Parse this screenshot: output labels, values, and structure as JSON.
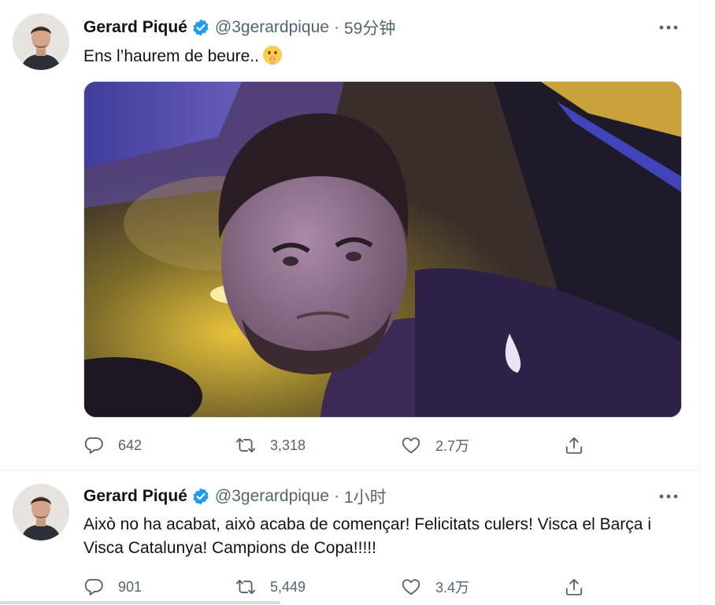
{
  "tweets": [
    {
      "author_name": "Gerard Piqué",
      "handle": "@3gerardpique",
      "separator": "·",
      "time": "59分钟",
      "text": "Ens l’haurem de beure..",
      "emoji": "shushing-face",
      "has_media": true,
      "replies": "642",
      "retweets": "3,318",
      "likes": "2.7万"
    },
    {
      "author_name": "Gerard Piqué",
      "handle": "@3gerardpique",
      "separator": "·",
      "time": "1小时",
      "text": "Això no ha acabat, això acaba de començar! Felicitats culers! Visca el Barça i Visca Catalunya! Campions de Copa!!!!!",
      "has_media": false,
      "replies": "901",
      "retweets": "5,449",
      "likes": "3.4万"
    }
  ],
  "colors": {
    "verified_badge": "#1d9bf0",
    "secondary_text": "#536471",
    "primary_text": "#0f1419"
  },
  "icons": [
    "reply-icon",
    "retweet-icon",
    "like-icon",
    "share-icon",
    "more-icon",
    "verified-icon"
  ]
}
